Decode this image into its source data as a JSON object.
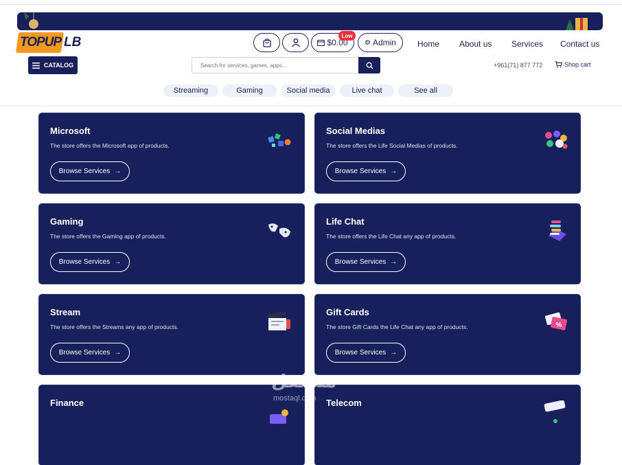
{
  "header": {
    "logo_part1": "TOPUP",
    "logo_part2": "LB",
    "wallet_amount": "$0.00",
    "wallet_badge": "Low",
    "admin_label": "Admin",
    "nav": [
      "Home",
      "About us",
      "Services",
      "Contact us"
    ],
    "catalog_label": "CATALOG",
    "search_placeholder": "Search for services, games, apps...",
    "phone": "+961(71) 877 772",
    "shop_cart": "Shop cart",
    "pills": [
      "Streaming",
      "Gaming",
      "Social media",
      "Live chat",
      "See all"
    ]
  },
  "colors": {
    "navy": "#17205a",
    "orange": "#f39a1e",
    "badge_red": "#ee2f3c"
  },
  "cards": [
    {
      "title": "Microsoft",
      "desc": "The store offers the Microsoft app of products.",
      "button": "Browse Services",
      "icon": "microsoft-products-icon"
    },
    {
      "title": "Social Medias",
      "desc": "The store offers the Life Social Medias of products.",
      "button": "Browse Services",
      "icon": "social-media-icon"
    },
    {
      "title": "Gaming",
      "desc": "The store offers the Gaming app of products.",
      "button": "Browse Services",
      "icon": "gamepad-icon"
    },
    {
      "title": "Life Chat",
      "desc": "The store offers the Life Chat any app of products.",
      "button": "Browse Services",
      "icon": "chat-phone-icon"
    },
    {
      "title": "Stream",
      "desc": "The store offers the Streams any app of products.",
      "button": "Browse Services",
      "icon": "clapperboard-icon"
    },
    {
      "title": "Gift Cards",
      "desc": "The store Gift Cards the Life Chat any app of products.",
      "button": "Browse Services",
      "icon": "gift-card-icon"
    },
    {
      "title": "Finance",
      "desc": "",
      "button": "",
      "icon": "finance-icon"
    },
    {
      "title": "Telecom",
      "desc": "",
      "button": "",
      "icon": "telecom-icon"
    }
  ],
  "watermark": {
    "main": "مستقل",
    "sub": "mostaql.com"
  }
}
